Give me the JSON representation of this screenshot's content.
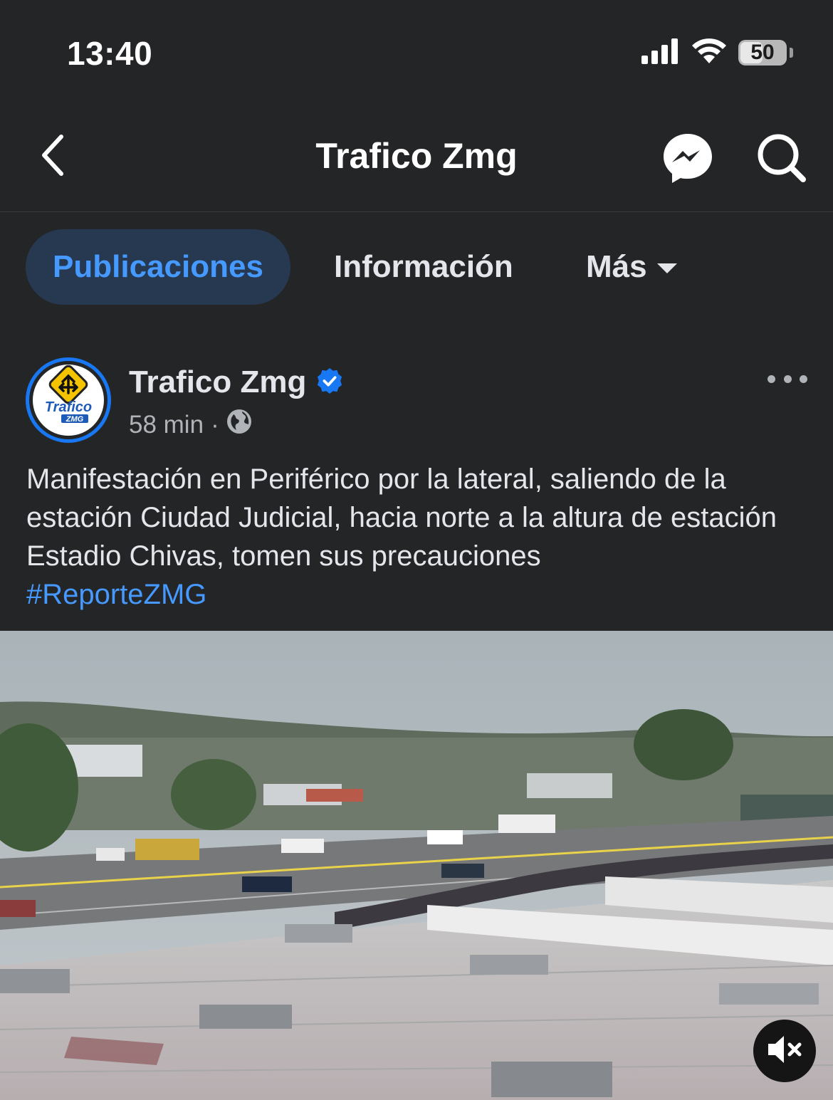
{
  "status_bar": {
    "time": "13:40",
    "battery": "50",
    "battery_level": 0.5,
    "icons": [
      "cellular-signal-icon",
      "wifi-icon",
      "battery-icon"
    ]
  },
  "nav": {
    "title": "Trafico Zmg",
    "icons": [
      "back-chevron-icon",
      "messenger-icon",
      "search-icon"
    ]
  },
  "tabs": [
    {
      "label": "Publicaciones",
      "active": true
    },
    {
      "label": "Información",
      "active": false
    },
    {
      "label": "Más",
      "active": false
    }
  ],
  "post": {
    "author": "Trafico Zmg",
    "verified": true,
    "time": "58 min",
    "separator": "·",
    "audience_icon": "globe-icon",
    "text": "Manifestación en Periférico por la lateral, saliendo de la estación Ciudad Judicial, hacia norte a la altura de estación Estadio Chivas, tomen sus precauciones",
    "hashtag": "#ReporteZMG",
    "avatar_logo": {
      "line1": "Trafico",
      "line2": "ZMG"
    },
    "video_muted": true
  },
  "colors": {
    "background": "#242526",
    "accent": "#4599ff",
    "verified": "#1877f2",
    "active_tab_bg": "#263951",
    "secondary_text": "#b0b3b8"
  }
}
